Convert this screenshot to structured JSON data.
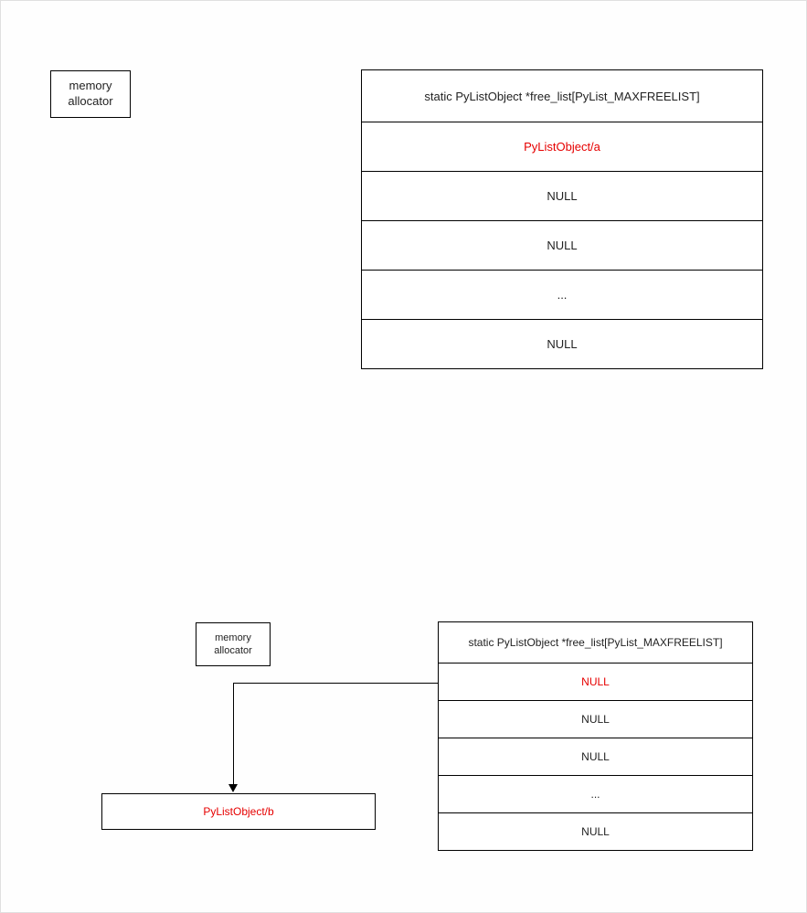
{
  "diagram1": {
    "allocator": "memory\nallocator",
    "freelist": {
      "header": "static PyListObject *free_list[PyList_MAXFREELIST]",
      "rows": [
        "PyListObject/a",
        "NULL",
        "NULL",
        "...",
        "NULL"
      ],
      "highlight_index": 0
    }
  },
  "diagram2": {
    "allocator": "memory\nallocator",
    "freelist": {
      "header": "static PyListObject *free_list[PyList_MAXFREELIST]",
      "rows": [
        "NULL",
        "NULL",
        "NULL",
        "...",
        "NULL"
      ],
      "highlight_index": 0
    },
    "result": "PyListObject/b"
  }
}
